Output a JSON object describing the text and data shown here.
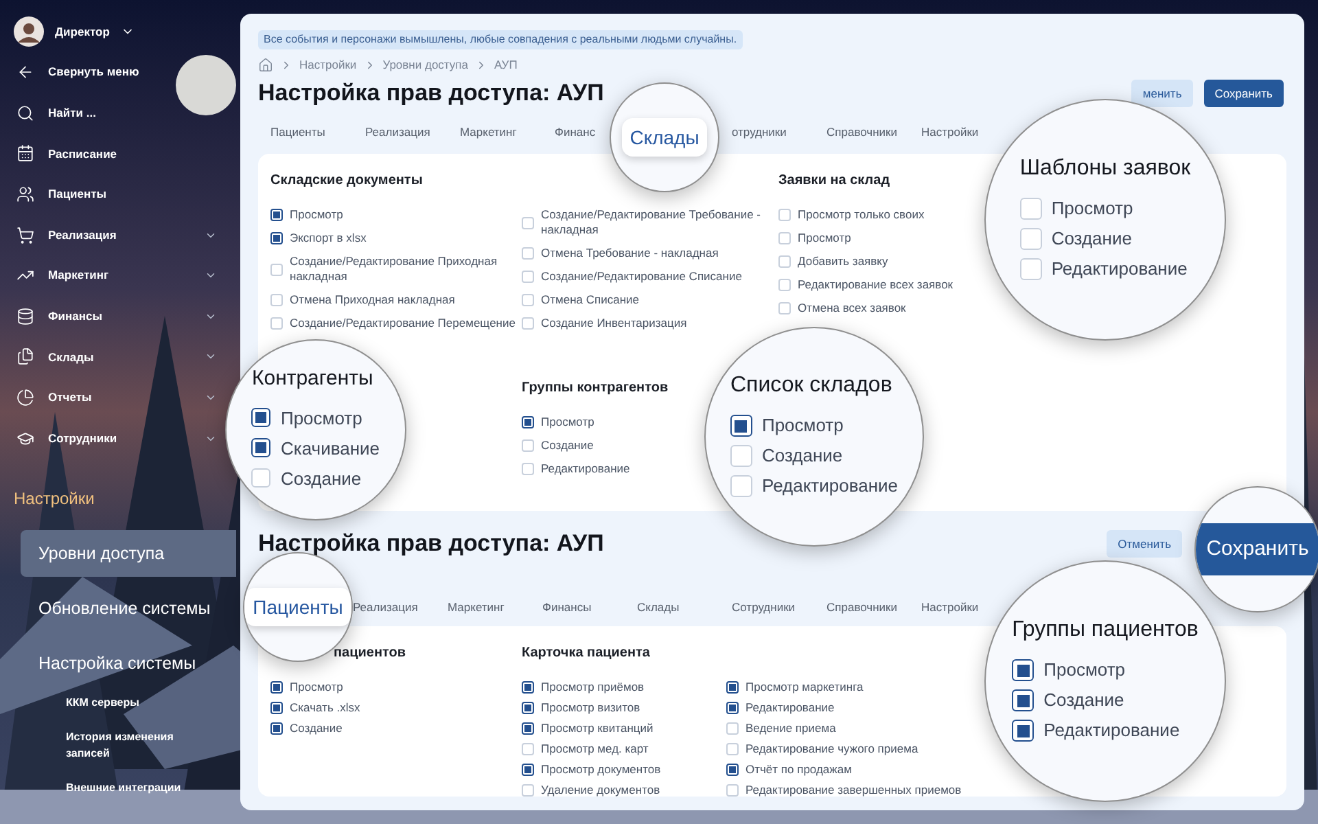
{
  "sidebar": {
    "user": {
      "name": "Директор"
    },
    "items": [
      {
        "label": "Свернуть меню",
        "expandable": false
      },
      {
        "label": "Найти ...",
        "expandable": false
      },
      {
        "label": "Расписание",
        "expandable": false
      },
      {
        "label": "Пациенты",
        "expandable": false
      },
      {
        "label": "Реализация",
        "expandable": true
      },
      {
        "label": "Маркетинг",
        "expandable": true
      },
      {
        "label": "Финансы",
        "expandable": true
      },
      {
        "label": "Склады",
        "expandable": true
      },
      {
        "label": "Отчеты",
        "expandable": true
      },
      {
        "label": "Сотрудники",
        "expandable": true
      }
    ],
    "section": {
      "title": "Настройки",
      "items": [
        {
          "label": "Уровни доступа",
          "selected": true
        },
        {
          "label": "Обновление системы",
          "selected": false
        },
        {
          "label": "Настройка системы",
          "selected": false,
          "children": [
            {
              "label": "ККМ серверы"
            },
            {
              "label": "История изменения записей"
            },
            {
              "label": "Внешние интеграции"
            }
          ]
        }
      ]
    }
  },
  "screens": [
    {
      "notice": "Все события и персонажи вымышлены, любые совпадения с реальными людьми случайны.",
      "breadcrumbs": [
        "Настройки",
        "Уровни доступа",
        "АУП"
      ],
      "title": "Настройка прав доступа: АУП",
      "buttons": [
        {
          "label": "менить",
          "kind": "cancel",
          "zoomed": false
        },
        {
          "label": "Сохранить",
          "kind": "save",
          "zoomed": false
        }
      ],
      "tabs": [
        {
          "label": "Пациенты",
          "selected": false
        },
        {
          "label": "Реализация",
          "selected": false
        },
        {
          "label": "Маркетинг",
          "selected": false
        },
        {
          "label": "Финанс",
          "selected": false
        },
        {
          "label": "Склады",
          "selected": true
        },
        {
          "label": "отрудники",
          "selected": false
        },
        {
          "label": "Справочники",
          "selected": false
        },
        {
          "label": "Настройки",
          "selected": false
        }
      ],
      "groups": [
        {
          "title": "Складские документы",
          "kind": "list",
          "columns": [
            [
              {
                "label": "Просмотр",
                "checked": true
              },
              {
                "label": "Экспорт в xlsx",
                "checked": true
              },
              {
                "label": "Создание/Редактирование Приходная накладная",
                "checked": false
              },
              {
                "label": "Отмена Приходная накладная",
                "checked": false
              },
              {
                "label": "Создание/Редактирование Перемещение",
                "checked": false
              }
            ],
            [
              {
                "label": "Создание/Редактирование Требование - накладная",
                "checked": false
              },
              {
                "label": "Отмена Требование - накладная",
                "checked": false
              },
              {
                "label": "Создание/Редактирование Списание",
                "checked": false
              },
              {
                "label": "Отмена Списание",
                "checked": false
              },
              {
                "label": "Создание Инвентаризация",
                "checked": false
              }
            ]
          ]
        },
        {
          "title": "Заявки на склад",
          "kind": "list",
          "columns": [
            [
              {
                "label": "Просмотр только своих",
                "checked": false
              },
              {
                "label": "Просмотр",
                "checked": false
              },
              {
                "label": "Добавить заявку",
                "checked": false
              },
              {
                "label": "Редактирование всех заявок",
                "checked": false
              },
              {
                "label": "Отмена всех заявок",
                "checked": false
              }
            ]
          ]
        },
        {
          "title": "Шаблоны заявок",
          "kind": "zoomed",
          "columns": [
            [
              {
                "label": "Просмотр",
                "checked": false
              },
              {
                "label": "Создание",
                "checked": false
              },
              {
                "label": "Редактирование",
                "checked": false
              }
            ]
          ]
        },
        {
          "title": "Контрагенты",
          "kind": "zoomed",
          "columns": [
            [
              {
                "label": "Просмотр",
                "checked": true
              },
              {
                "label": "Скачивание",
                "checked": true
              },
              {
                "label": "Создание",
                "checked": false
              }
            ]
          ]
        },
        {
          "title": "Группы контрагентов",
          "kind": "list",
          "columns": [
            [
              {
                "label": "Просмотр",
                "checked": true
              },
              {
                "label": "Создание",
                "checked": false
              },
              {
                "label": "Редактирование",
                "checked": false
              }
            ]
          ]
        },
        {
          "title": "Список складов",
          "kind": "zoomed",
          "columns": [
            [
              {
                "label": "Просмотр",
                "checked": true
              },
              {
                "label": "Создание",
                "checked": false
              },
              {
                "label": "Редактирование",
                "checked": false
              }
            ]
          ]
        }
      ]
    },
    {
      "title": "Настройка прав доступа: АУП",
      "buttons": [
        {
          "label": "Отменить",
          "kind": "cancel",
          "zoomed": false
        },
        {
          "label": "Сохранить",
          "kind": "save",
          "zoomed": true
        }
      ],
      "tabs": [
        {
          "label": "Пациенты",
          "selected": true
        },
        {
          "label": "Реализация",
          "selected": false
        },
        {
          "label": "Маркетинг",
          "selected": false
        },
        {
          "label": "Финансы",
          "selected": false
        },
        {
          "label": "Склады",
          "selected": false
        },
        {
          "label": "Сотрудники",
          "selected": false
        },
        {
          "label": "Справочники",
          "selected": false
        },
        {
          "label": "Настройки",
          "selected": false
        }
      ],
      "groups": [
        {
          "title": "пациентов",
          "kind": "list",
          "columns": [
            [
              {
                "label": "Просмотр",
                "checked": true
              },
              {
                "label": "Скачать .xlsx",
                "checked": true
              },
              {
                "label": "Создание",
                "checked": true
              }
            ]
          ]
        },
        {
          "title": "Карточка пациента",
          "kind": "list",
          "columns": [
            [
              {
                "label": "Просмотр приёмов",
                "checked": true
              },
              {
                "label": "Просмотр визитов",
                "checked": true
              },
              {
                "label": "Просмотр квитанций",
                "checked": true
              },
              {
                "label": "Просмотр мед. карт",
                "checked": false
              },
              {
                "label": "Просмотр документов",
                "checked": true
              },
              {
                "label": "Удаление документов",
                "checked": false
              }
            ],
            [
              {
                "label": "Просмотр маркетинга",
                "checked": true
              },
              {
                "label": "Редактирование",
                "checked": true
              },
              {
                "label": "Ведение приема",
                "checked": false
              },
              {
                "label": "Редактирование чужого приема",
                "checked": false
              },
              {
                "label": "Отчёт по продажам",
                "checked": true
              },
              {
                "label": "Редактирование завершенных приемов",
                "checked": false
              }
            ]
          ]
        },
        {
          "title": "Группы пациентов",
          "kind": "zoomed",
          "columns": [
            [
              {
                "label": "Просмотр",
                "checked": true
              },
              {
                "label": "Создание",
                "checked": true
              },
              {
                "label": "Редактирование",
                "checked": true
              }
            ]
          ]
        }
      ]
    }
  ]
}
